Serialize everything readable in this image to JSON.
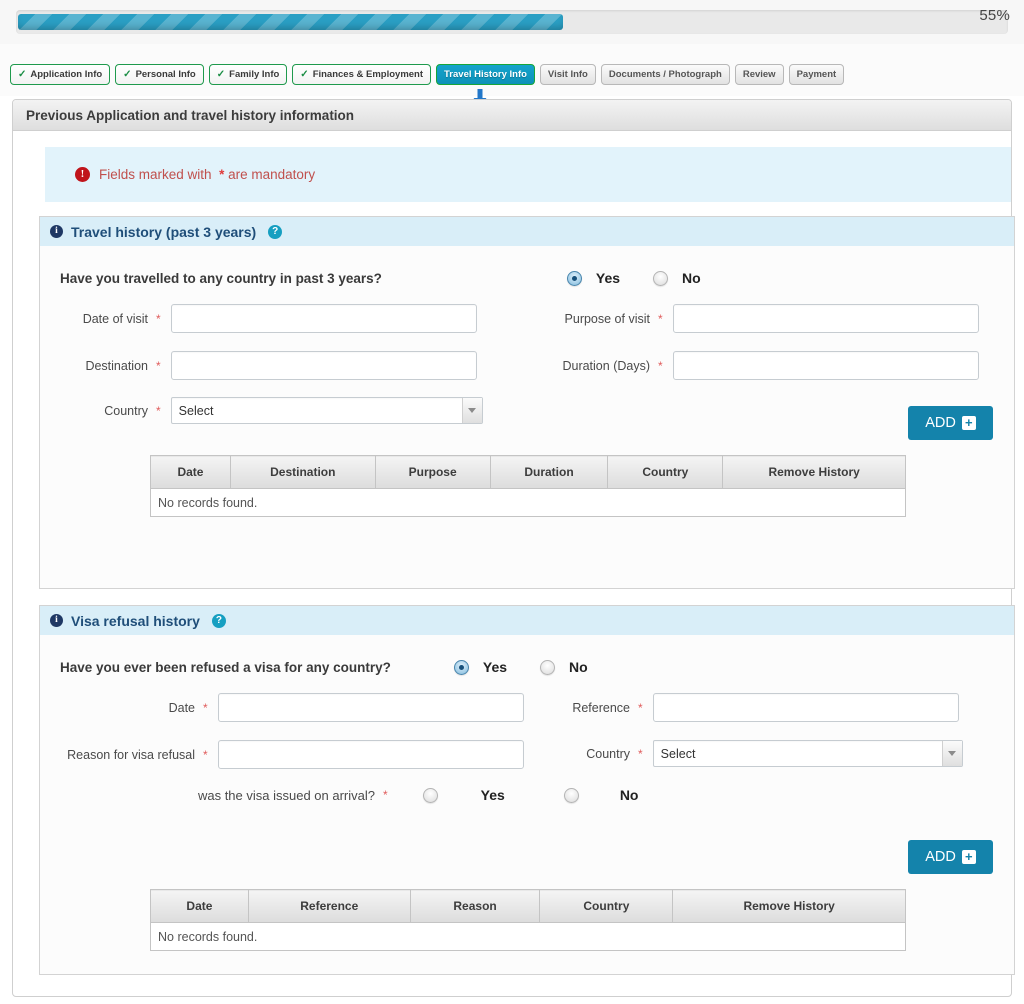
{
  "progress": {
    "percent_label": "55%",
    "percent_value": 55
  },
  "wizard": {
    "tabs": [
      {
        "label": "Application Info",
        "state": "done",
        "check": "✓"
      },
      {
        "label": "Personal Info",
        "state": "done",
        "check": "✓"
      },
      {
        "label": "Family Info",
        "state": "done",
        "check": "✓"
      },
      {
        "label": "Finances & Employment",
        "state": "done",
        "check": "✓"
      },
      {
        "label": "Travel History Info",
        "state": "active",
        "check": ""
      },
      {
        "label": "Visit Info",
        "state": "pending",
        "check": ""
      },
      {
        "label": "Documents / Photograph",
        "state": "pending",
        "check": ""
      },
      {
        "label": "Review",
        "state": "pending",
        "check": ""
      },
      {
        "label": "Payment",
        "state": "pending",
        "check": ""
      }
    ]
  },
  "panel": {
    "title": "Previous Application and travel history information"
  },
  "notice": {
    "icon": "!",
    "text_before": "Fields marked with",
    "star": "*",
    "text_after": "are mandatory"
  },
  "travel_section": {
    "info_icon": "i",
    "title": "Travel history (past 3 years)",
    "help_icon": "?",
    "question": "Have you travelled to any country in past 3 years?",
    "yes_label": "Yes",
    "no_label": "No",
    "selected": "Yes",
    "fields": {
      "date_of_visit": {
        "label": "Date of visit",
        "required": "*",
        "value": ""
      },
      "destination": {
        "label": "Destination",
        "required": "*",
        "value": ""
      },
      "country": {
        "label": "Country",
        "required": "*",
        "value": "Select"
      },
      "purpose_of_visit": {
        "label": "Purpose of visit",
        "required": "*",
        "value": ""
      },
      "duration_days": {
        "label": "Duration (Days)",
        "required": "*",
        "value": ""
      }
    },
    "add_button": {
      "label": "ADD",
      "icon": "+"
    },
    "table": {
      "headers": [
        "Date",
        "Destination",
        "Purpose",
        "Duration",
        "Country",
        "Remove History"
      ],
      "empty_text": "No records found."
    }
  },
  "refusal_section": {
    "info_icon": "i",
    "title": "Visa refusal history",
    "help_icon": "?",
    "question": "Have you ever been refused a visa for any country?",
    "yes_label": "Yes",
    "no_label": "No",
    "selected": "Yes",
    "fields": {
      "date": {
        "label": "Date",
        "required": "*",
        "value": ""
      },
      "reason": {
        "label": "Reason for visa refusal",
        "required": "*",
        "value": ""
      },
      "reference": {
        "label": "Reference",
        "required": "*",
        "value": ""
      },
      "country": {
        "label": "Country",
        "required": "*",
        "value": "Select"
      }
    },
    "arrival_question": {
      "label": "was the visa issued on arrival?",
      "required": "*",
      "yes_label": "Yes",
      "no_label": "No",
      "selected": ""
    },
    "add_button": {
      "label": "ADD",
      "icon": "+"
    },
    "table": {
      "headers": [
        "Date",
        "Reference",
        "Reason",
        "Country",
        "Remove History"
      ],
      "empty_text": "No records found."
    }
  },
  "colors": {
    "accent_teal": "#1483ab",
    "progress_fill": "#2a9fc4",
    "active_tab": "#14a4cc",
    "done_tab_border": "#1f9a4d",
    "section_header": "#d9eef8",
    "notice_bg": "#e2f3fb",
    "required_star": "#e05c5c",
    "notice_text": "#c0504d",
    "section_title": "#1f4e79"
  }
}
